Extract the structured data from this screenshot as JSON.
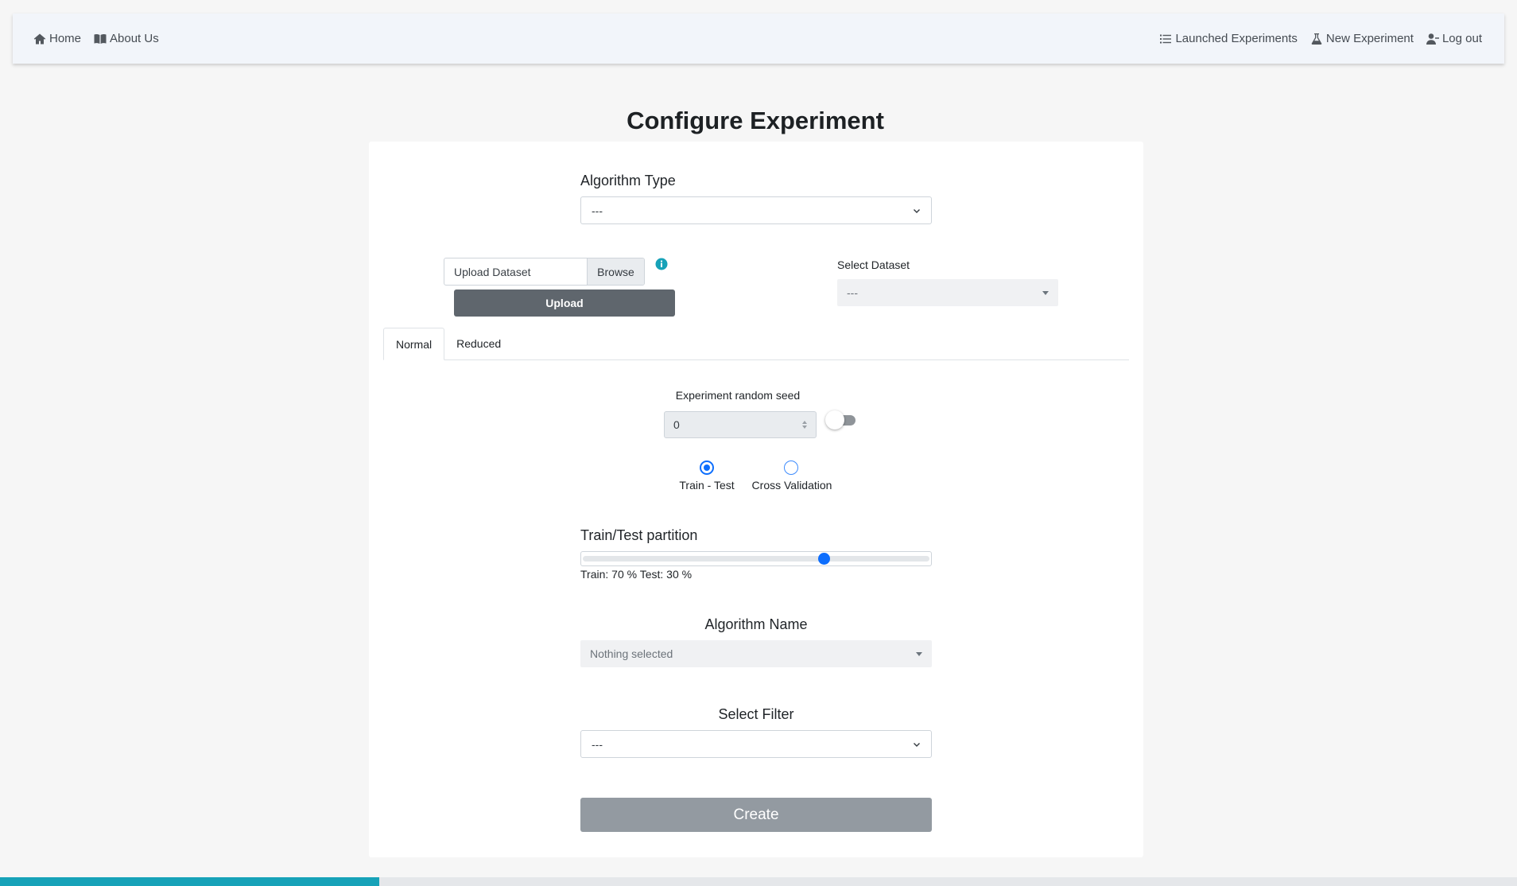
{
  "nav": {
    "home": "Home",
    "about": "About Us",
    "launched": "Launched Experiments",
    "new_experiment": "New Experiment",
    "logout": "Log out"
  },
  "page_title": "Configure Experiment",
  "algorithm_type": {
    "label": "Algorithm Type",
    "value": "---"
  },
  "upload": {
    "file_label": "Upload Dataset",
    "browse": "Browse",
    "button": "Upload",
    "info_color": "#17a2b8"
  },
  "select_dataset": {
    "label": "Select Dataset",
    "value": "---"
  },
  "tabs": [
    {
      "label": "Normal",
      "active": true
    },
    {
      "label": "Reduced",
      "active": false
    }
  ],
  "seed": {
    "label": "Experiment random seed",
    "value": "0",
    "toggle_on": false
  },
  "validation": {
    "options": [
      {
        "label": "Train - Test",
        "checked": true
      },
      {
        "label": "Cross Validation",
        "checked": false
      }
    ]
  },
  "partition": {
    "label": "Train/Test partition",
    "train_percent": 70,
    "readout": "Train: 70 % Test: 30 %"
  },
  "algorithm_name": {
    "label": "Algorithm Name",
    "placeholder": "Nothing selected"
  },
  "filter": {
    "label": "Select Filter",
    "value": "---"
  },
  "create_button": "Create",
  "bottom_progress_fraction": 0.25,
  "colors": {
    "accent": "#0d6efd",
    "info": "#17a2b8",
    "upload_button": "#5f666d",
    "create_button": "#939aa1"
  }
}
